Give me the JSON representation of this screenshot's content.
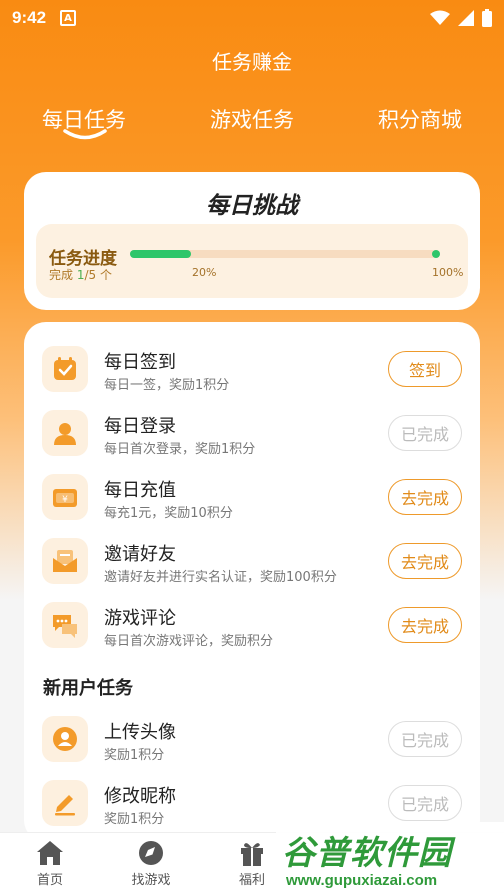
{
  "status_bar": {
    "time": "9:42",
    "a_badge": "A"
  },
  "header": {
    "title": "任务赚金"
  },
  "tabs": [
    {
      "label": "每日任务"
    },
    {
      "label": "游戏任务"
    },
    {
      "label": "积分商城"
    }
  ],
  "challenge": {
    "title": "每日挑战",
    "progress_label": "任务进度",
    "completed_prefix": "完成 ",
    "completed_count": "1",
    "completed_suffix": "/5 个",
    "progress_fraction": 0.2,
    "tick_mid": "20%",
    "tick_end": "100%"
  },
  "daily_tasks": [
    {
      "name": "每日签到",
      "desc": "每日一签，奖励1积分",
      "button": "签到",
      "done": false,
      "icon": "calendar-check-icon"
    },
    {
      "name": "每日登录",
      "desc": "每日首次登录，奖励1积分",
      "button": "已完成",
      "done": true,
      "icon": "user-icon"
    },
    {
      "name": "每日充值",
      "desc": "每充1元，奖励10积分",
      "button": "去完成",
      "done": false,
      "icon": "wallet-icon"
    },
    {
      "name": "邀请好友",
      "desc": "邀请好友并进行实名认证，奖励100积分",
      "button": "去完成",
      "done": false,
      "icon": "envelope-icon"
    },
    {
      "name": "游戏评论",
      "desc": "每日首次游戏评论，奖励积分",
      "button": "去完成",
      "done": false,
      "icon": "chat-icon"
    }
  ],
  "new_user": {
    "section_title": "新用户任务",
    "tasks": [
      {
        "name": "上传头像",
        "desc": "奖励1积分",
        "button": "已完成",
        "done": true,
        "icon": "avatar-icon"
      },
      {
        "name": "修改昵称",
        "desc": "奖励1积分",
        "button": "已完成",
        "done": true,
        "icon": "edit-icon"
      }
    ]
  },
  "bottom_nav": [
    {
      "label": "首页",
      "icon": "home-icon"
    },
    {
      "label": "找游戏",
      "icon": "compass-icon"
    },
    {
      "label": "福利",
      "icon": "gift-icon"
    }
  ],
  "watermark": {
    "text": "谷普软件园",
    "url": "www.gupuxiazai.com"
  },
  "colors": {
    "primary": "#f98b12",
    "accent_green": "#2ec66a",
    "button_orange": "#e18b1a"
  }
}
